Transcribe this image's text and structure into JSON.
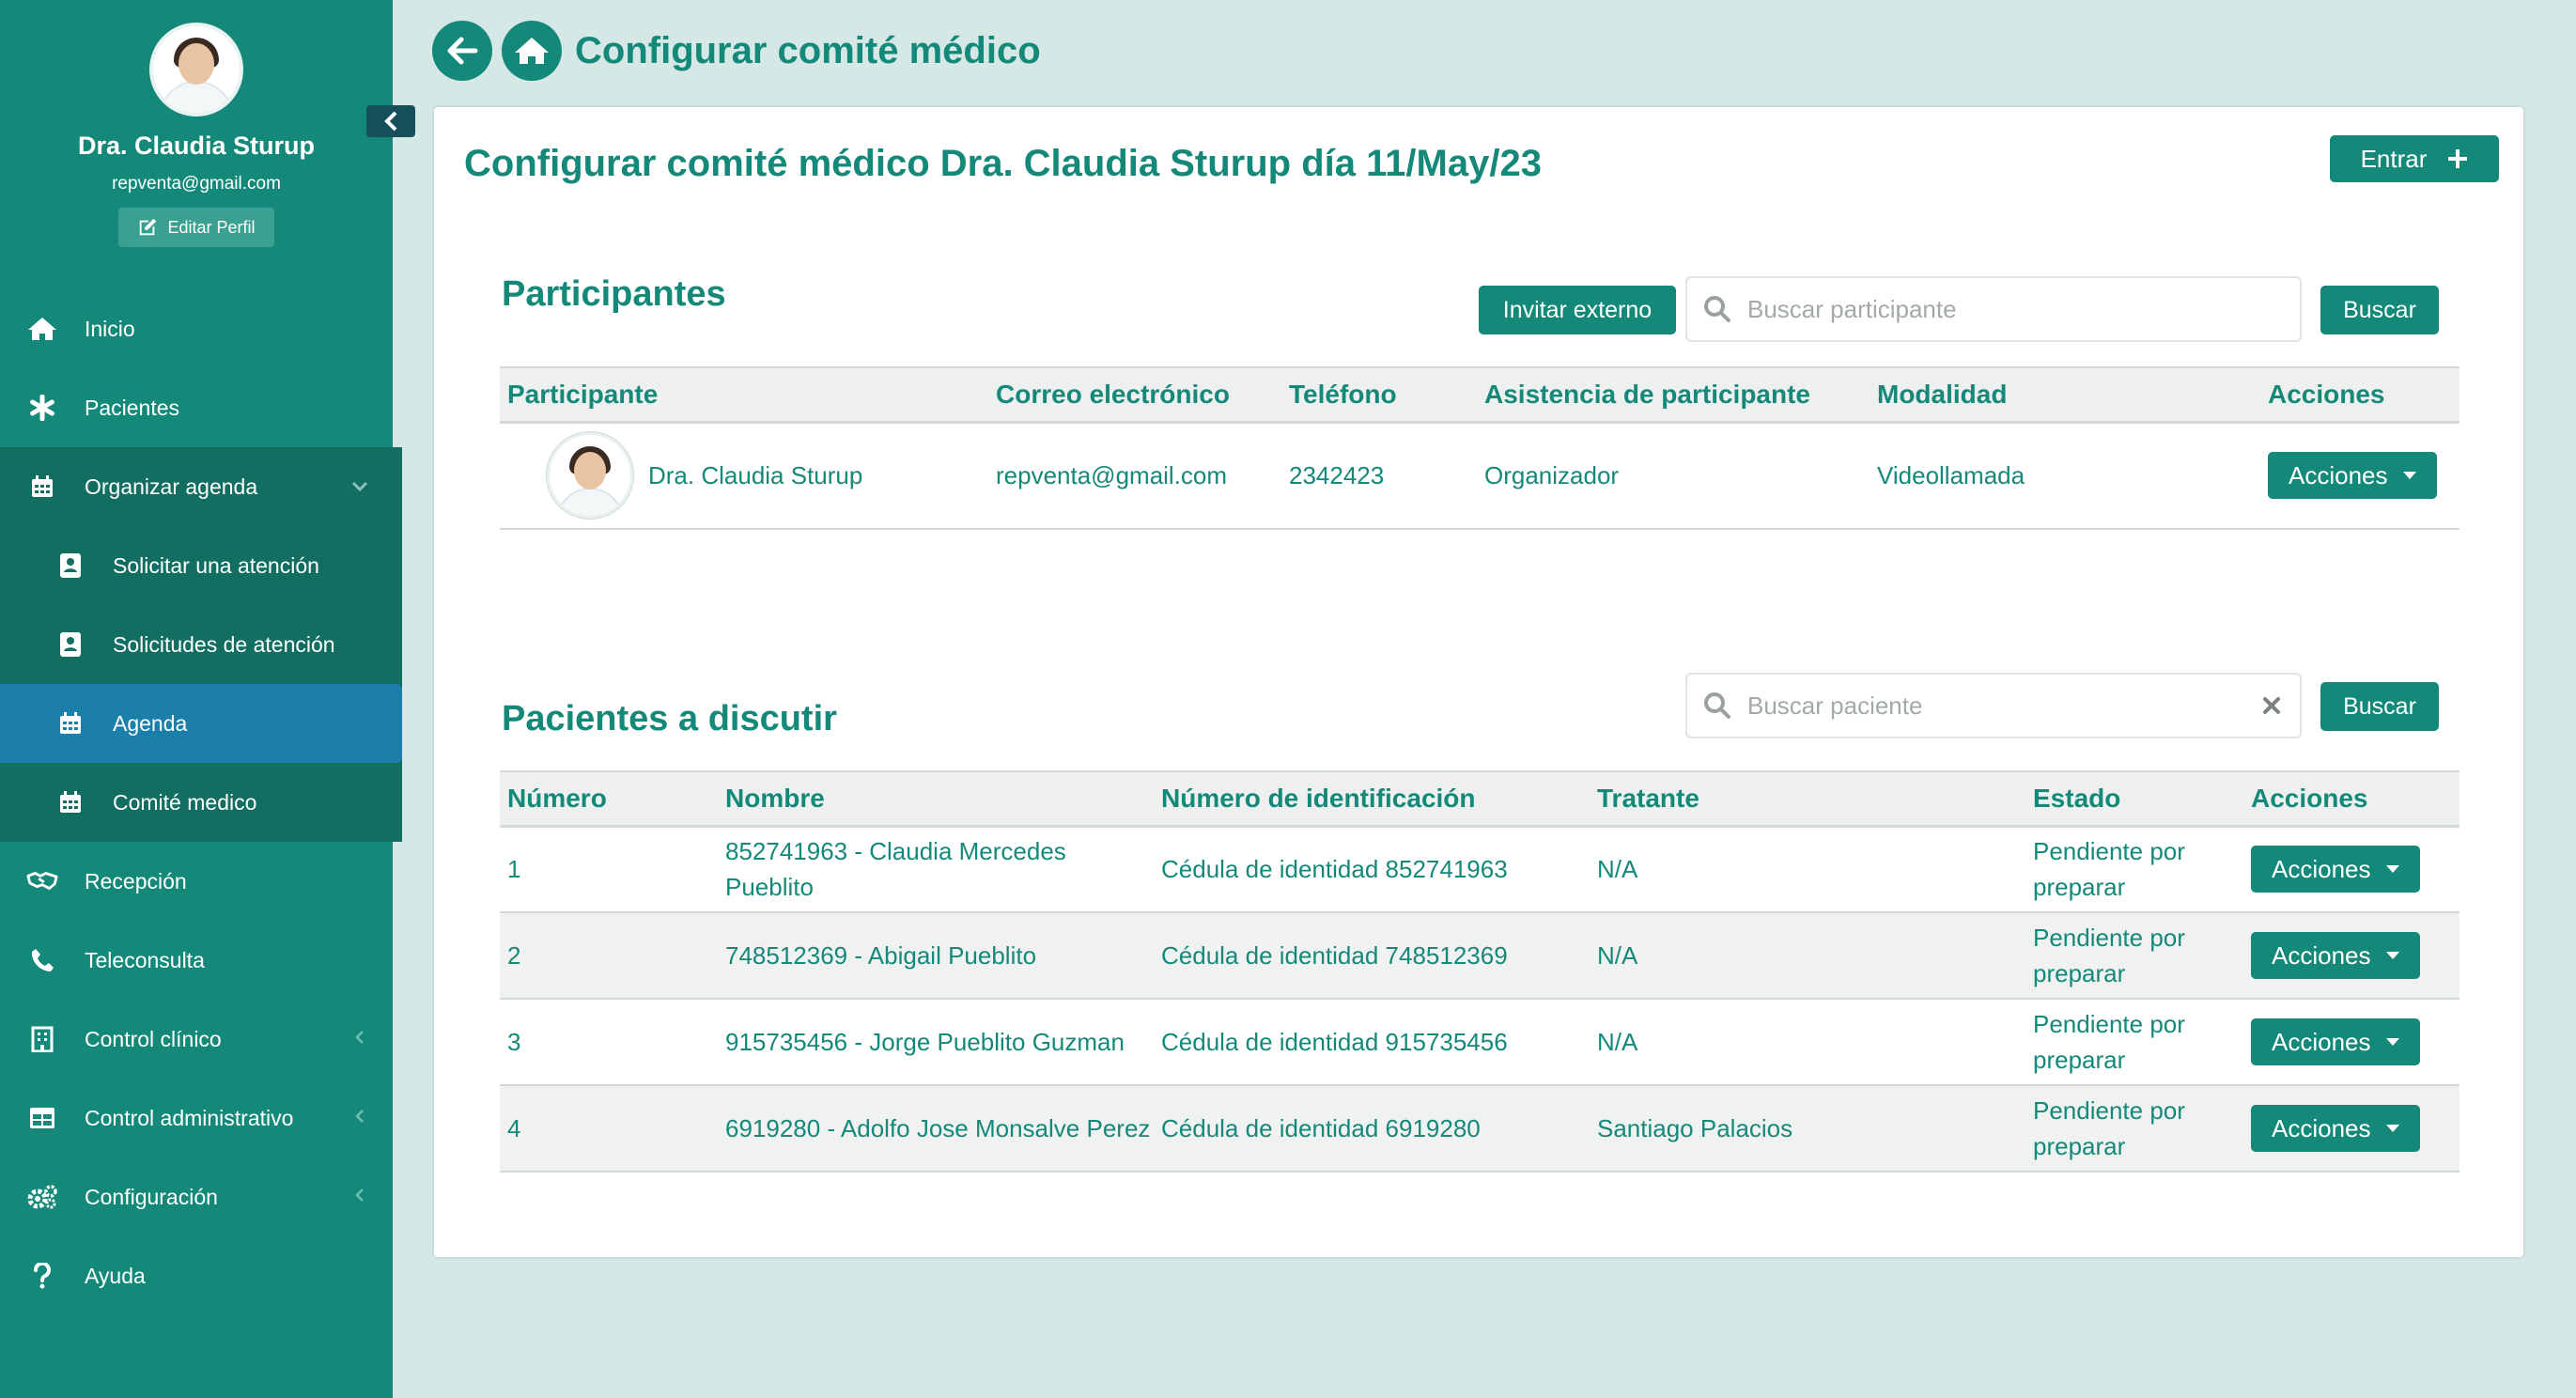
{
  "sidebar": {
    "profile": {
      "name": "Dra. Claudia Sturup",
      "email": "repventa@gmail.com",
      "edit_label": "Editar Perfil"
    },
    "items": [
      {
        "label": "Inicio",
        "icon": "home-icon"
      },
      {
        "label": "Pacientes",
        "icon": "asterisk-icon"
      },
      {
        "label": "Organizar agenda",
        "icon": "calendar-icon"
      },
      {
        "label": "Solicitar una atención",
        "icon": "contact-card-icon"
      },
      {
        "label": "Solicitudes de atención",
        "icon": "contact-card-icon"
      },
      {
        "label": "Agenda",
        "icon": "calendar-icon"
      },
      {
        "label": "Comité medico",
        "icon": "calendar-icon"
      },
      {
        "label": "Recepción",
        "icon": "handshake-icon"
      },
      {
        "label": "Teleconsulta",
        "icon": "phone-icon"
      },
      {
        "label": "Control clínico",
        "icon": "hospital-icon"
      },
      {
        "label": "Control administrativo",
        "icon": "table-icon"
      },
      {
        "label": "Configuración",
        "icon": "gears-icon"
      },
      {
        "label": "Ayuda",
        "icon": "question-icon"
      }
    ]
  },
  "header": {
    "title": "Configurar comité médico"
  },
  "card": {
    "title": "Configurar comité médico Dra. Claudia Sturup día 11/May/23",
    "enter_label": "Entrar"
  },
  "participants": {
    "title": "Participantes",
    "invite_label": "Invitar externo",
    "search_placeholder": "Buscar participante",
    "search_button": "Buscar",
    "headers": [
      "Participante",
      "Correo electrónico",
      "Teléfono",
      "Asistencia de participante",
      "Modalidad",
      "Acciones"
    ],
    "rows": [
      {
        "name": "Dra. Claudia Sturup",
        "email": "repventa@gmail.com",
        "phone": "2342423",
        "attendance": "Organizador",
        "mode": "Videollamada",
        "action": "Acciones"
      }
    ]
  },
  "patients": {
    "title": "Pacientes a discutir",
    "search_placeholder": "Buscar paciente",
    "search_button": "Buscar",
    "headers": [
      "Número",
      "Nombre",
      "Número de identificación",
      "Tratante",
      "Estado",
      "Acciones"
    ],
    "rows": [
      {
        "num": "1",
        "name": "852741963 - Claudia Mercedes Pueblito",
        "id": "Cédula de identidad 852741963",
        "doctor": "N/A",
        "status": "Pendiente por preparar",
        "action": "Acciones"
      },
      {
        "num": "2",
        "name": "748512369 - Abigail Pueblito",
        "id": "Cédula de identidad 748512369",
        "doctor": "N/A",
        "status": "Pendiente por preparar",
        "action": "Acciones"
      },
      {
        "num": "3",
        "name": "915735456 - Jorge Pueblito Guzman",
        "id": "Cédula de identidad 915735456",
        "doctor": "N/A",
        "status": "Pendiente por preparar",
        "action": "Acciones"
      },
      {
        "num": "4",
        "name": "6919280 - Adolfo Jose Monsalve Perez",
        "id": "Cédula de identidad 6919280",
        "doctor": "Santiago Palacios",
        "status": "Pendiente por preparar",
        "action": "Acciones"
      }
    ]
  },
  "colors": {
    "primary": "#148979",
    "active_nav": "#1b7faa",
    "background": "#d6e8e6"
  }
}
